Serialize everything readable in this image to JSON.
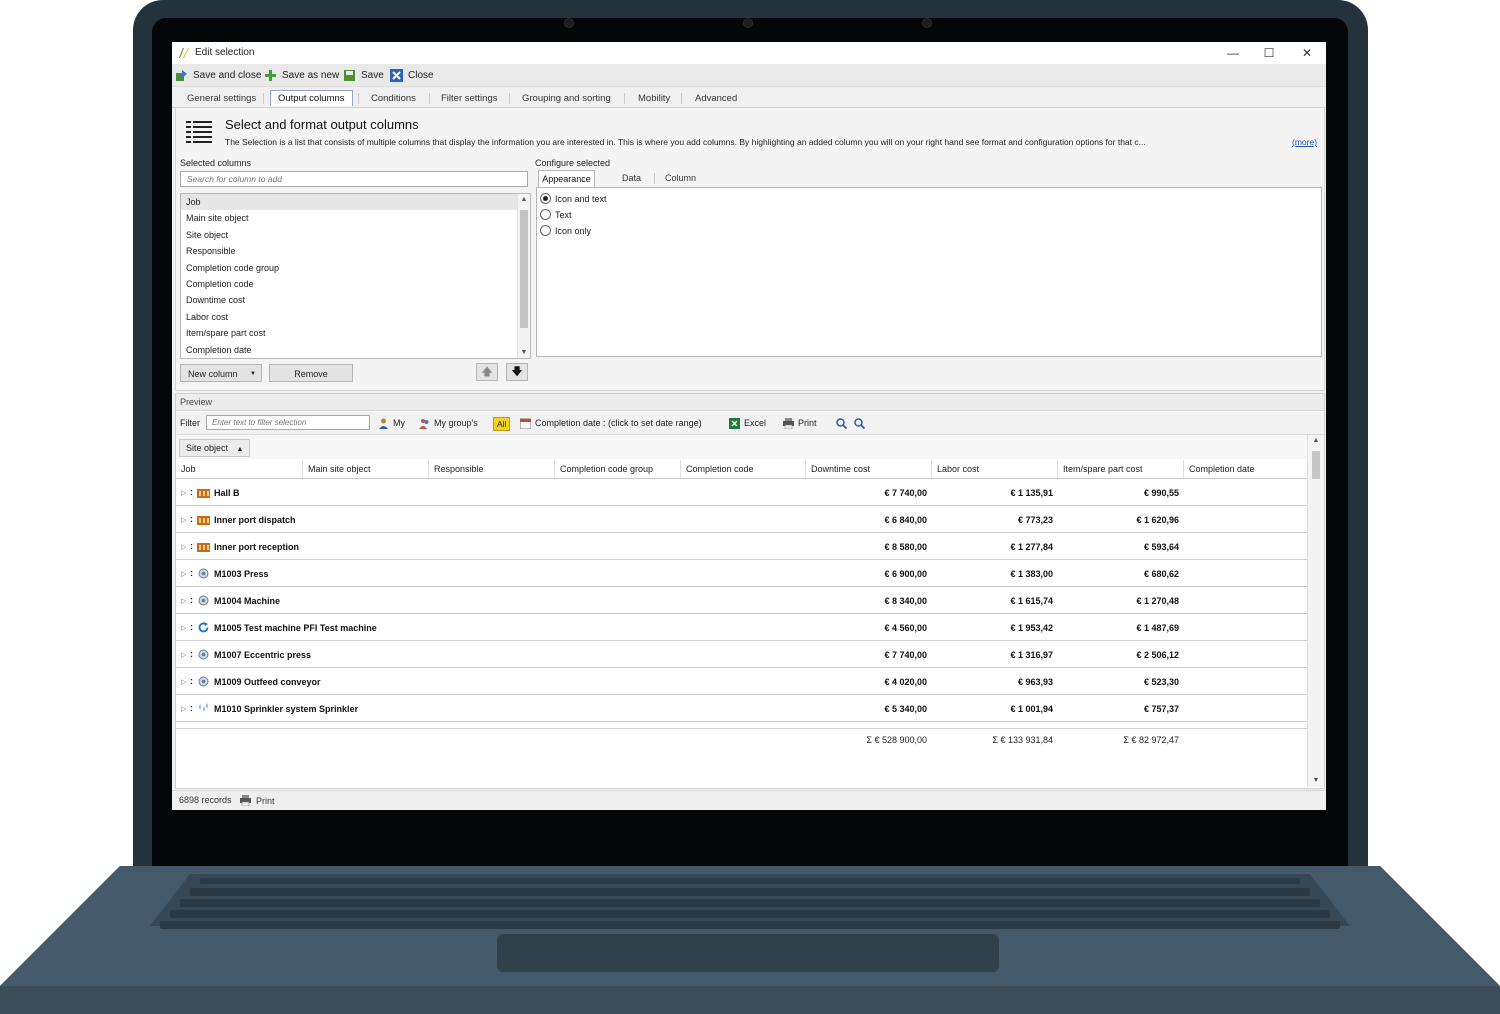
{
  "window": {
    "title": "Edit selection",
    "minimize": "—",
    "maximize": "☐",
    "close": "✕"
  },
  "toolbar": {
    "save_and_close": "Save and close",
    "save_as_new": "Save as new",
    "save": "Save",
    "close": "Close"
  },
  "tabs": [
    "General settings",
    "Output columns",
    "Conditions",
    "Filter settings",
    "Grouping and sorting",
    "Mobility",
    "Advanced"
  ],
  "active_tab": "Output columns",
  "header": {
    "title": "Select and format output columns",
    "description": "The Selection is a list that consists of multiple columns that display the information you are interested in. This is where you add columns. By highlighting an added column you will on your right hand see format and configuration options for that c...",
    "more": "(more)"
  },
  "selected_columns": {
    "label": "Selected columns",
    "search_placeholder": "Search for column to add",
    "items": [
      "Job",
      "Main site object",
      "Site object",
      "Responsible",
      "Completion code group",
      "Completion code",
      "Downtime cost",
      "Labor cost",
      "Item/spare part cost",
      "Completion date"
    ],
    "selected": "Job",
    "new_column": "New column",
    "remove": "Remove"
  },
  "configure": {
    "label": "Configure selected",
    "tabs": [
      "Appearance",
      "Data",
      "Column"
    ],
    "options": [
      "Icon and text",
      "Text",
      "Icon only"
    ],
    "selected_option": "Icon and text"
  },
  "preview": {
    "title": "Preview",
    "filter_label": "Filter",
    "filter_placeholder": "Enter text to filter selection",
    "my": "My",
    "my_groups": "My group's",
    "all": "All",
    "completion_date": "Completion date : (click to set date range)",
    "excel": "Excel",
    "print": "Print",
    "group_by": "Site object",
    "columns": [
      "Job",
      "Main site object",
      "Responsible",
      "Completion code group",
      "Completion code",
      "Downtime cost",
      "Labor cost",
      "Item/spare part cost",
      "Completion date"
    ],
    "rows": [
      {
        "name": "Hall B",
        "icon": "building-icon",
        "downtime": "€ 7 740,00",
        "labor": "€ 1 135,91",
        "item": "€ 990,55"
      },
      {
        "name": "Inner port dispatch",
        "icon": "building-icon",
        "downtime": "€ 6 840,00",
        "labor": "€ 773,23",
        "item": "€ 1 620,96"
      },
      {
        "name": "Inner port reception",
        "icon": "building-icon",
        "downtime": "€ 8 580,00",
        "labor": "€ 1 277,84",
        "item": "€ 593,64"
      },
      {
        "name": "M1003  Press",
        "icon": "machine-icon",
        "downtime": "€ 6 900,00",
        "labor": "€ 1 383,00",
        "item": "€ 680,62"
      },
      {
        "name": "M1004  Machine",
        "icon": "machine-icon",
        "downtime": "€ 8 340,00",
        "labor": "€ 1 615,74",
        "item": "€ 1 270,48"
      },
      {
        "name": "M1005 Test machine PFI Test machine",
        "icon": "refresh-icon",
        "downtime": "€ 4 560,00",
        "labor": "€ 1 953,42",
        "item": "€ 1 487,69"
      },
      {
        "name": "M1007  Eccentric press",
        "icon": "machine-icon",
        "downtime": "€ 7 740,00",
        "labor": "€ 1 316,97",
        "item": "€ 2 506,12"
      },
      {
        "name": "M1009  Outfeed conveyor",
        "icon": "machine-icon",
        "downtime": "€ 4 020,00",
        "labor": "€ 963,93",
        "item": "€ 523,30"
      },
      {
        "name": "M1010 Sprinkler system Sprinkler",
        "icon": "sprinkler-icon",
        "downtime": "€ 5 340,00",
        "labor": "€ 1 001,94",
        "item": "€ 757,37"
      }
    ],
    "totals": {
      "downtime": "Σ € 528 900,00",
      "labor": "Σ € 133 931,84",
      "item": "Σ € 82 972,47"
    }
  },
  "status": {
    "records": "6898 records",
    "print": "Print"
  }
}
